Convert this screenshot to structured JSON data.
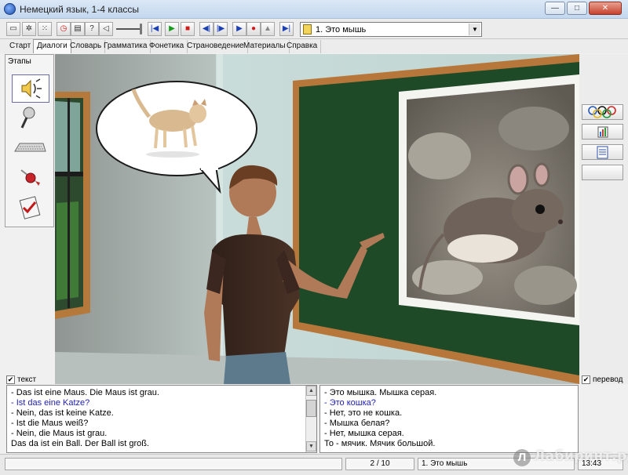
{
  "window": {
    "title": "Немецкий язык, 1-4 классы",
    "minimize": "—",
    "maximize": "□",
    "close": "✕"
  },
  "toolbar": {
    "lesson_value": "1. Это мышь",
    "buttons": [
      {
        "name": "folder-icon",
        "glyph": "▭"
      },
      {
        "name": "gear-icon",
        "glyph": "✲"
      },
      {
        "name": "dice-icon",
        "glyph": "⁙"
      },
      {
        "name": "clock-icon",
        "glyph": "◷"
      },
      {
        "name": "printer-icon",
        "glyph": "▤"
      },
      {
        "name": "help-icon",
        "glyph": "?"
      },
      {
        "name": "volume-icon",
        "glyph": "◁"
      }
    ],
    "player": [
      {
        "name": "first-icon",
        "glyph": "|◀"
      },
      {
        "name": "play-icon",
        "glyph": "▶"
      },
      {
        "name": "stop-icon",
        "glyph": "■"
      },
      {
        "name": "rewind-icon",
        "glyph": "◀|"
      },
      {
        "name": "forward-icon",
        "glyph": "|▶"
      },
      {
        "name": "play2-icon",
        "glyph": "▶"
      },
      {
        "name": "record-icon",
        "glyph": "●"
      },
      {
        "name": "eject-icon",
        "glyph": "▲"
      },
      {
        "name": "last-icon",
        "glyph": "▶|"
      }
    ]
  },
  "tabs": [
    "Старт",
    "Диалоги",
    "Словарь",
    "Грамматика",
    "Фонетика",
    "Страноведение",
    "Материалы",
    "Справка"
  ],
  "active_tab": "Диалоги",
  "stages": {
    "label": "Этапы"
  },
  "options": {
    "text_label": "текст",
    "translation_label": "перевод",
    "check_mark": "✔"
  },
  "dialogue_de": [
    "- Das ist eine Maus. Die Maus ist grau.",
    "- Ist das eine Katze?",
    "- Nein, das ist keine Katze.",
    "- Ist die Maus weiß?",
    "- Nein, die Maus ist grau.",
    "Das da ist ein Ball. Der Ball ist groß."
  ],
  "dialogue_ru": [
    "- Это мышка. Мышка серая.",
    "- Это кошка?",
    "- Нет, это не кошка.",
    "- Мышка белая?",
    "- Нет, мышка серая.",
    "То - мячик. Мячик большой."
  ],
  "highlighted_line": 1,
  "statusbar": {
    "page": "2 / 10",
    "lesson": "1. Это мышь",
    "time": "13:43"
  },
  "watermark": "Лабиринт.ру",
  "watermark_logo": "Л",
  "colors": {
    "board": "#1f4a27",
    "board_frame": "#b7773a",
    "wall": "#c8dedb",
    "highlight_text": "#1c1cb6"
  }
}
